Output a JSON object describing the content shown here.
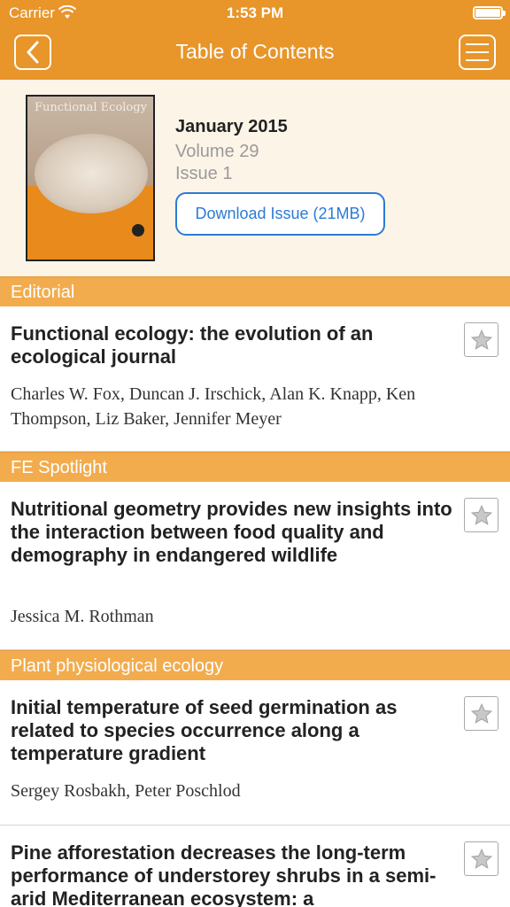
{
  "status_bar": {
    "carrier": "Carrier",
    "time": "1:53 PM"
  },
  "nav": {
    "title": "Table of Contents",
    "back_icon": "chevron-left-icon",
    "menu_icon": "hamburger-menu-icon"
  },
  "issue": {
    "cover_title": "Functional Ecology",
    "date": "January 2015",
    "volume": "Volume 29",
    "issue": "Issue 1",
    "download_label": "Download Issue (21MB)"
  },
  "sections": [
    {
      "label": "Editorial",
      "articles": [
        {
          "title": "Functional ecology: the evolution of an ecological journal",
          "authors": "Charles W. Fox, Duncan J. Irschick, Alan K. Knapp, Ken Thompson, Liz Baker, Jennifer Meyer"
        }
      ]
    },
    {
      "label": "FE Spotlight",
      "articles": [
        {
          "title": "Nutritional geometry provides new insights into the interaction between food quality and demography in endangered wildlife",
          "authors": "Jessica M. Rothman"
        }
      ]
    },
    {
      "label": "Plant physiological ecology",
      "articles": [
        {
          "title": "Initial temperature of seed germination as related to species occurrence along a temperature gradient",
          "authors": "Sergey Rosbakh, Peter Poschlod"
        },
        {
          "title": "Pine afforestation decreases the long-term performance of understorey shrubs in a semi-arid Mediterranean ecosystem: a",
          "authors": ""
        }
      ]
    }
  ],
  "colors": {
    "accent": "#e8952a",
    "section": "#f2ac4d",
    "link": "#2a7bd6",
    "header_bg": "#fdf4e8"
  }
}
